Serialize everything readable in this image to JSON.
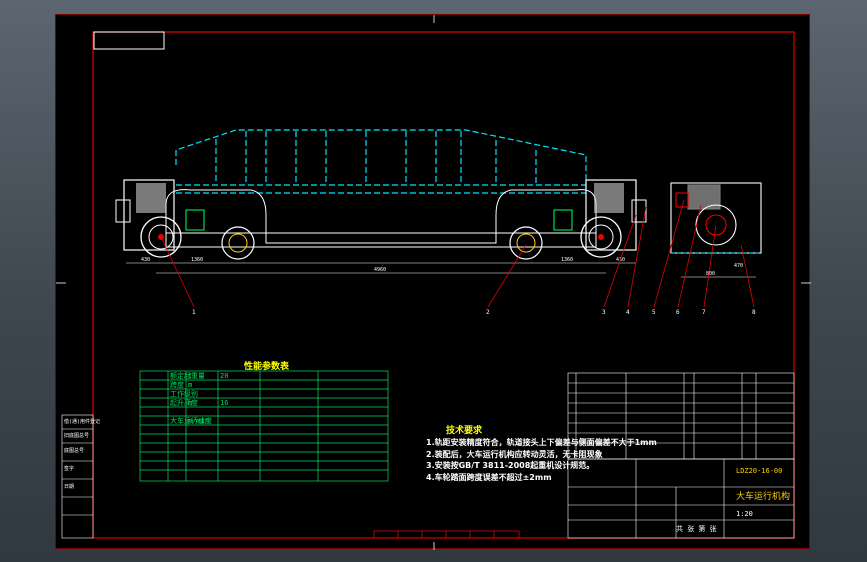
{
  "performance_table": {
    "title": "性能参数表",
    "rows": [
      [
        "",
        "额定起重量",
        "t",
        "20"
      ],
      [
        "",
        "跨度",
        "m",
        "",
        ""
      ],
      [
        "",
        "工作级别",
        "",
        "",
        ""
      ],
      [
        "",
        "起升高度",
        "m",
        "16"
      ],
      [
        "",
        "",
        "",
        "",
        ""
      ],
      [
        "",
        "大车运行速度",
        "m/min",
        "",
        ""
      ]
    ]
  },
  "tech_requirements": {
    "title": "技术要求",
    "lines": [
      "1.轨距安装精度符合，轨道接头上下偏差与侧面偏差不大于1mm",
      "2.装配后，大车运行机构应转动灵活，无卡阻现象",
      "3.安装按GB/T 3811-2008起重机设计规范。",
      "4.车轮踏面跨度误差不超过±2mm"
    ]
  },
  "title_block": {
    "drawing_name": "大车运行机构",
    "drawing_no": "LDZ20-16-00",
    "scale": "1:20",
    "sheet": "共 张 第 张"
  },
  "dims": {
    "span_total": "4960",
    "left_wheel": "1360",
    "right_wheel": "1360",
    "left_edge": "430",
    "right_edge": "430",
    "side_total": "800",
    "side_part": "470"
  },
  "part_labels": [
    "1",
    "2",
    "3",
    "4",
    "5",
    "6",
    "7",
    "8"
  ],
  "left_column": [
    "借(通)用件登记",
    "旧底图总号",
    "底图总号",
    "签字",
    "日期"
  ]
}
